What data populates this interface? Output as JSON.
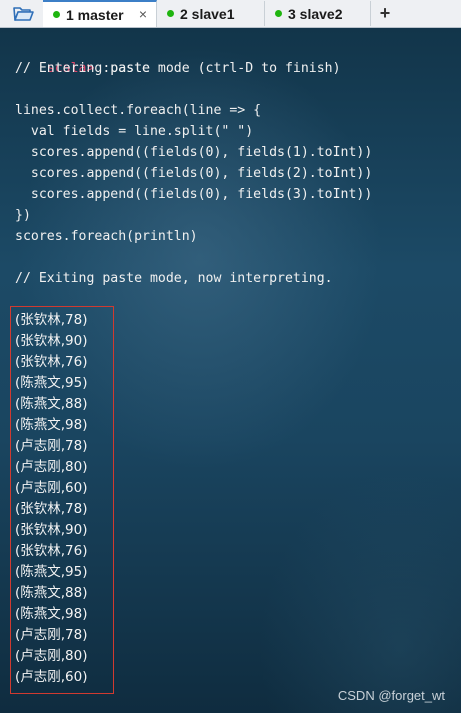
{
  "tabs": [
    {
      "label": "1 master",
      "active": true
    },
    {
      "label": "2 slave1",
      "active": false
    },
    {
      "label": "3 slave2",
      "active": false
    }
  ],
  "close_glyph": "×",
  "add_glyph": "+",
  "terminal": {
    "prompt": "scala>",
    "command": " :paste",
    "lines": [
      "// Entering paste mode (ctrl-D to finish)",
      "",
      "lines.collect.foreach(line => {",
      "  val fields = line.split(\" \")",
      "  scores.append((fields(0), fields(1).toInt))",
      "  scores.append((fields(0), fields(2).toInt))",
      "  scores.append((fields(0), fields(3).toInt))",
      "})",
      "scores.foreach(println)",
      "",
      "// Exiting paste mode, now interpreting."
    ],
    "results": [
      "(张钦林,78)",
      "(张钦林,90)",
      "(张钦林,76)",
      "(陈燕文,95)",
      "(陈燕文,88)",
      "(陈燕文,98)",
      "(卢志刚,78)",
      "(卢志刚,80)",
      "(卢志刚,60)",
      "(张钦林,78)",
      "(张钦林,90)",
      "(张钦林,76)",
      "(陈燕文,95)",
      "(陈燕文,88)",
      "(陈燕文,98)",
      "(卢志刚,78)",
      "(卢志刚,80)",
      "(卢志刚,60)"
    ]
  },
  "watermark": "CSDN @forget_wt",
  "colors": {
    "prompt": "#e0486b",
    "active_tab_accent": "#3c7fc7",
    "connected_dot": "#1fb50f",
    "highlight_box": "#d03a30"
  },
  "icons": {
    "folder": "folder-open-icon",
    "status": "connected-dot-icon",
    "close": "close-icon",
    "add": "add-tab-icon"
  }
}
